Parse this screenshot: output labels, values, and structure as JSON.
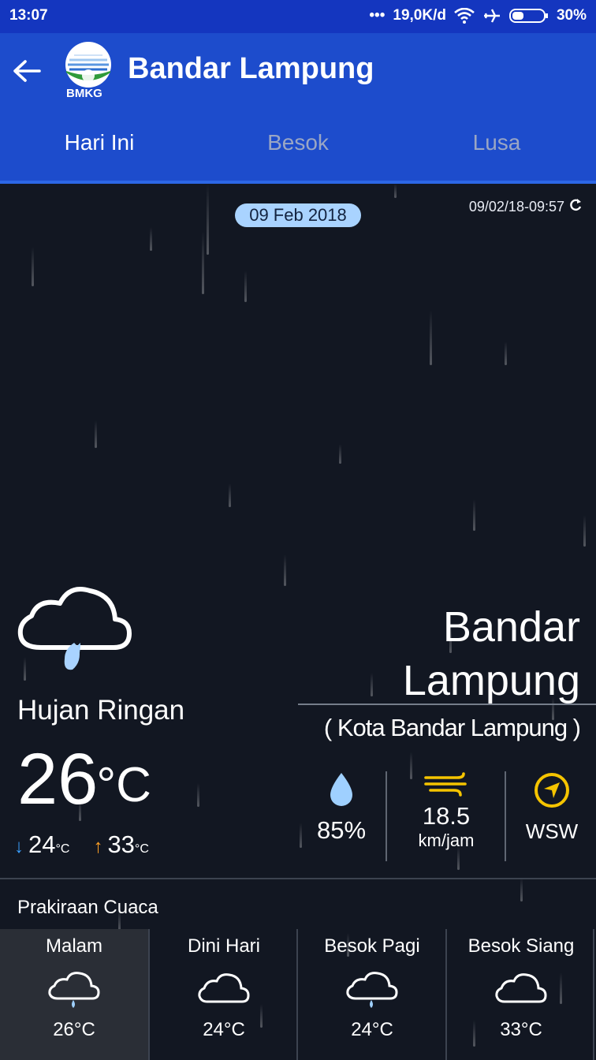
{
  "status_bar": {
    "time": "13:07",
    "speed": "19,0K/d",
    "battery": "30%"
  },
  "app_bar": {
    "title": "Bandar Lampung",
    "logo_text": "BMKG",
    "back_icon": "arrow-left-icon"
  },
  "tabs": [
    {
      "label": "Hari Ini",
      "active": true
    },
    {
      "label": "Besok",
      "active": false
    },
    {
      "label": "Lusa",
      "active": false
    }
  ],
  "main": {
    "date": "09 Feb 2018",
    "updated": "09/02/18-09:57",
    "condition": "Hujan Ringan",
    "temp": "26",
    "temp_unit": "°C",
    "min_temp": "24",
    "max_temp": "33",
    "mini_unit": "°C",
    "city_line1": "Bandar",
    "city_line2": "Lampung",
    "kota": "( Kota Bandar Lampung )",
    "humidity": "85%",
    "wind_speed": "18.5",
    "wind_unit": "km/jam",
    "wind_dir": "WSW"
  },
  "forecast": {
    "title": "Prakiraan Cuaca",
    "items": [
      {
        "label": "Malam",
        "temp": "26°C",
        "icon": "cloud-rain-icon",
        "selected": true
      },
      {
        "label": "Dini Hari",
        "temp": "24°C",
        "icon": "cloud-icon",
        "selected": false
      },
      {
        "label": "Besok Pagi",
        "temp": "24°C",
        "icon": "cloud-rain-icon",
        "selected": false
      },
      {
        "label": "Besok Siang",
        "temp": "33°C",
        "icon": "cloud-icon",
        "selected": false
      }
    ]
  },
  "colors": {
    "status_bar": "#1436bf",
    "app_bar": "#1d4ccc",
    "background": "#121722",
    "date_pill": "#a9d3ff",
    "accent_yellow": "#f5c400",
    "raindrop": "#a9d3ff"
  }
}
